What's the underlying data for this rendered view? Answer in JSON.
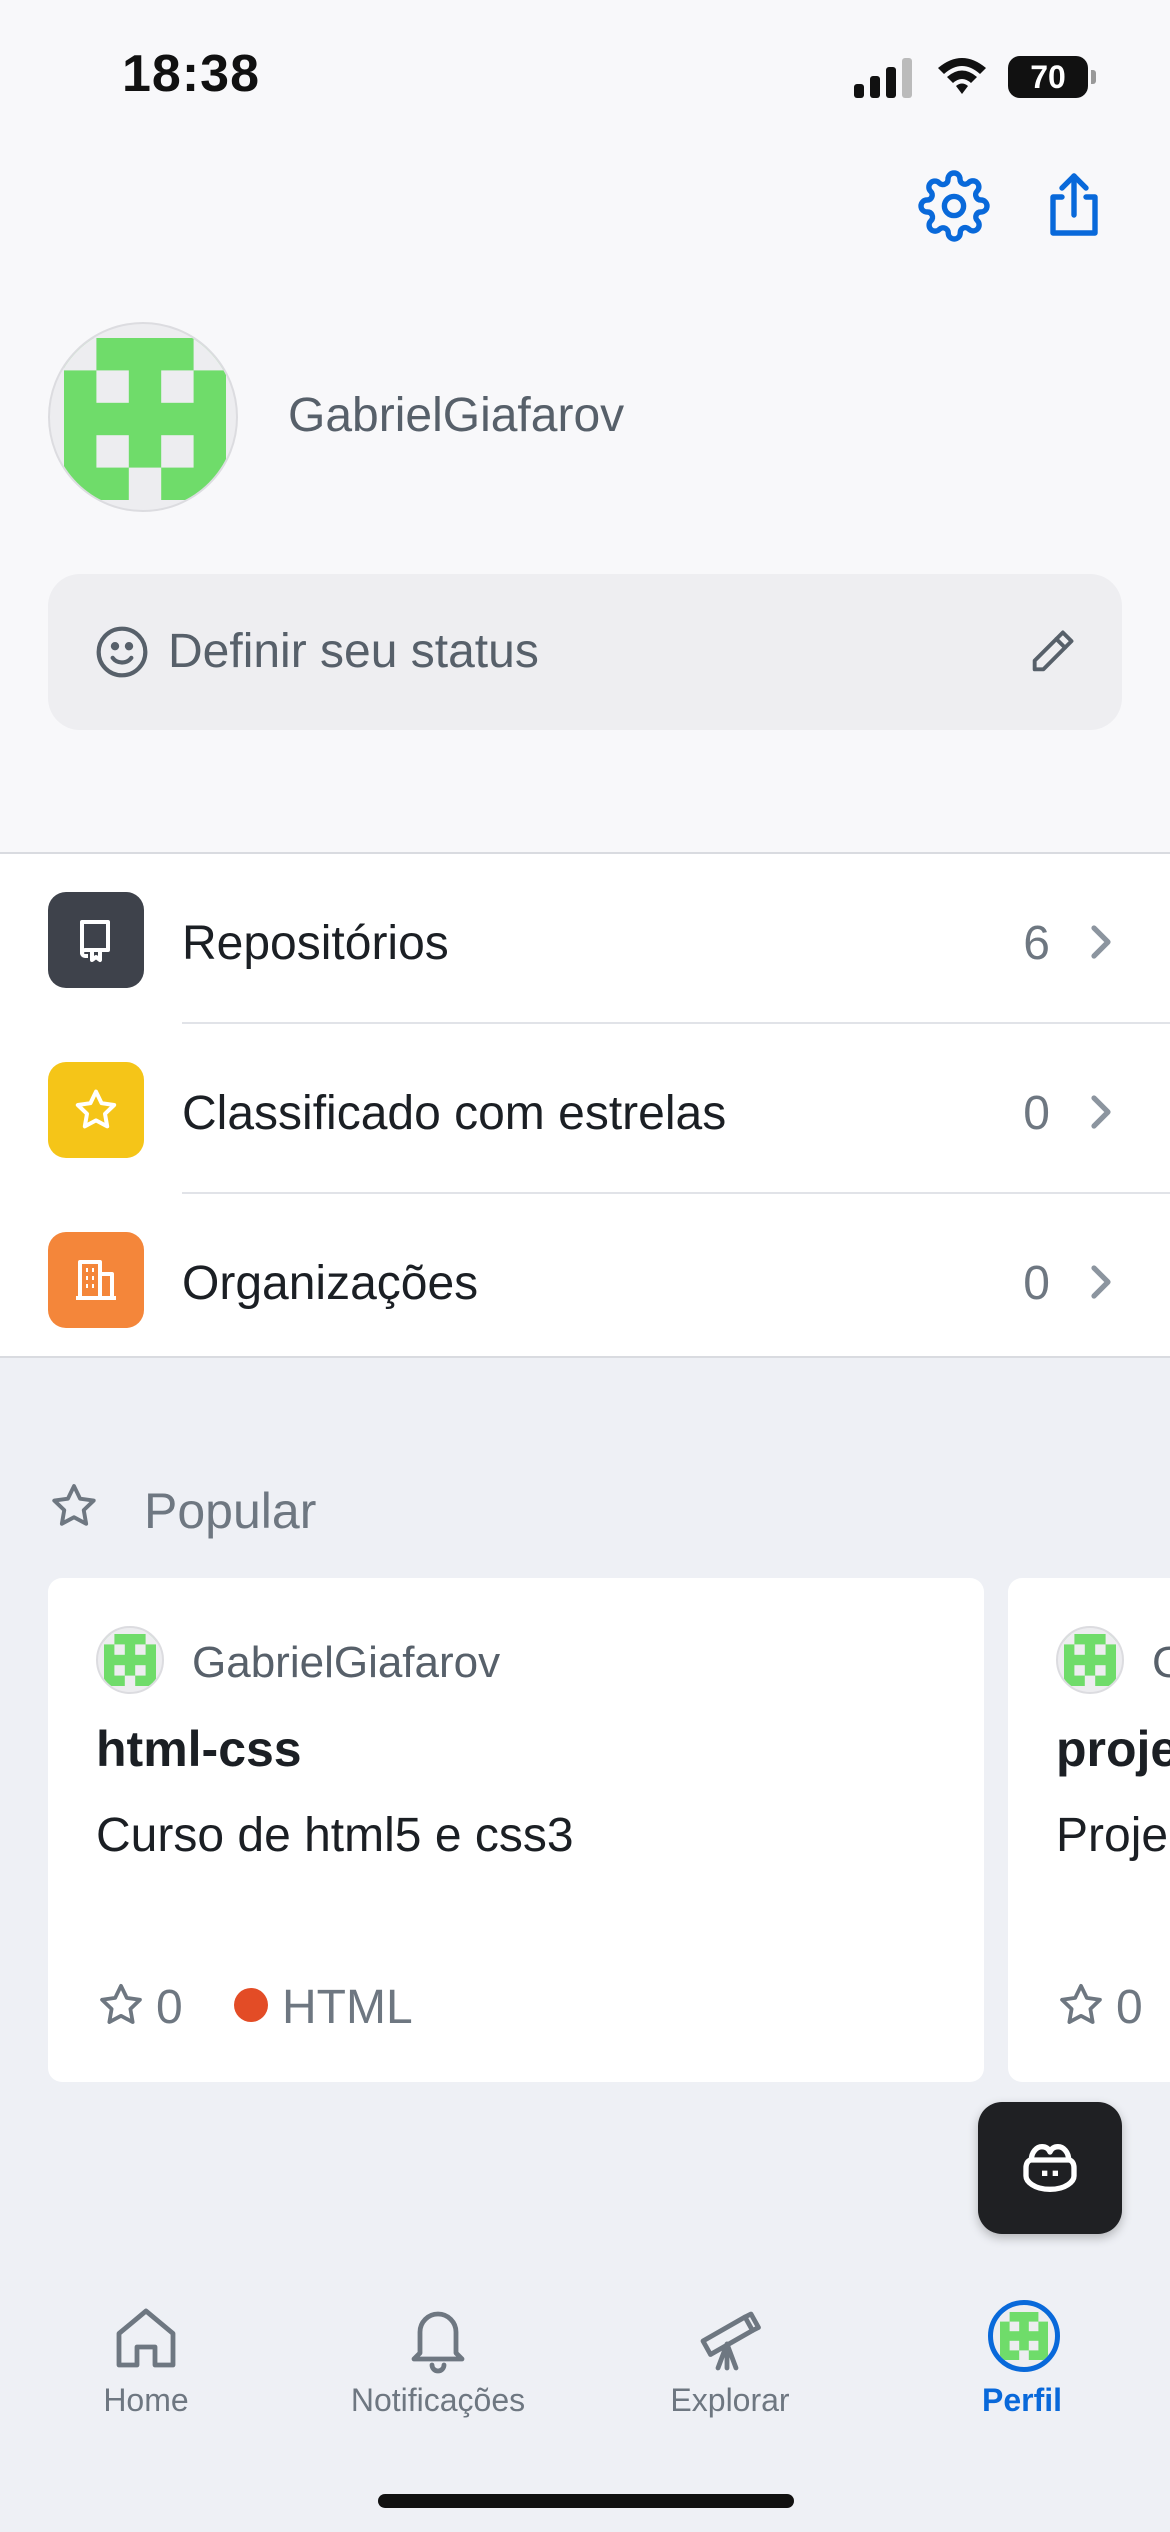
{
  "statusbar": {
    "time": "18:38",
    "battery": "70"
  },
  "header": {
    "settings_icon": "gear-icon",
    "share_icon": "share-icon"
  },
  "profile": {
    "username": "GabrielGiafarov",
    "avatar_color": "#6fdc6a"
  },
  "status": {
    "label": "Definir seu status",
    "icon": "smiley-icon",
    "edit_icon": "pencil-icon"
  },
  "menu": [
    {
      "label": "Repositórios",
      "count": "6",
      "icon": "repo-icon",
      "color": "#3e424b"
    },
    {
      "label": "Classificado com estrelas",
      "count": "0",
      "icon": "star-icon",
      "color": "#f5c518"
    },
    {
      "label": "Organizações",
      "count": "0",
      "icon": "organization-icon",
      "color": "#f4863a"
    }
  ],
  "popular": {
    "title": "Popular",
    "cards": [
      {
        "owner": "GabrielGiafarov",
        "name": "html-css",
        "description": "Curso de html5 e css3",
        "stars": "0",
        "language": "HTML",
        "language_color": "#e34c26"
      },
      {
        "owner": "G",
        "name": "proje",
        "description": "Proje",
        "stars": "0"
      }
    ]
  },
  "tabs": [
    {
      "label": "Home",
      "icon": "home-icon"
    },
    {
      "label": "Notificações",
      "icon": "bell-icon"
    },
    {
      "label": "Explorar",
      "icon": "telescope-icon"
    },
    {
      "label": "Perfil",
      "icon": "avatar",
      "active": true
    }
  ],
  "colors": {
    "accent": "#0969da",
    "identicon": "#6fdc6a"
  }
}
